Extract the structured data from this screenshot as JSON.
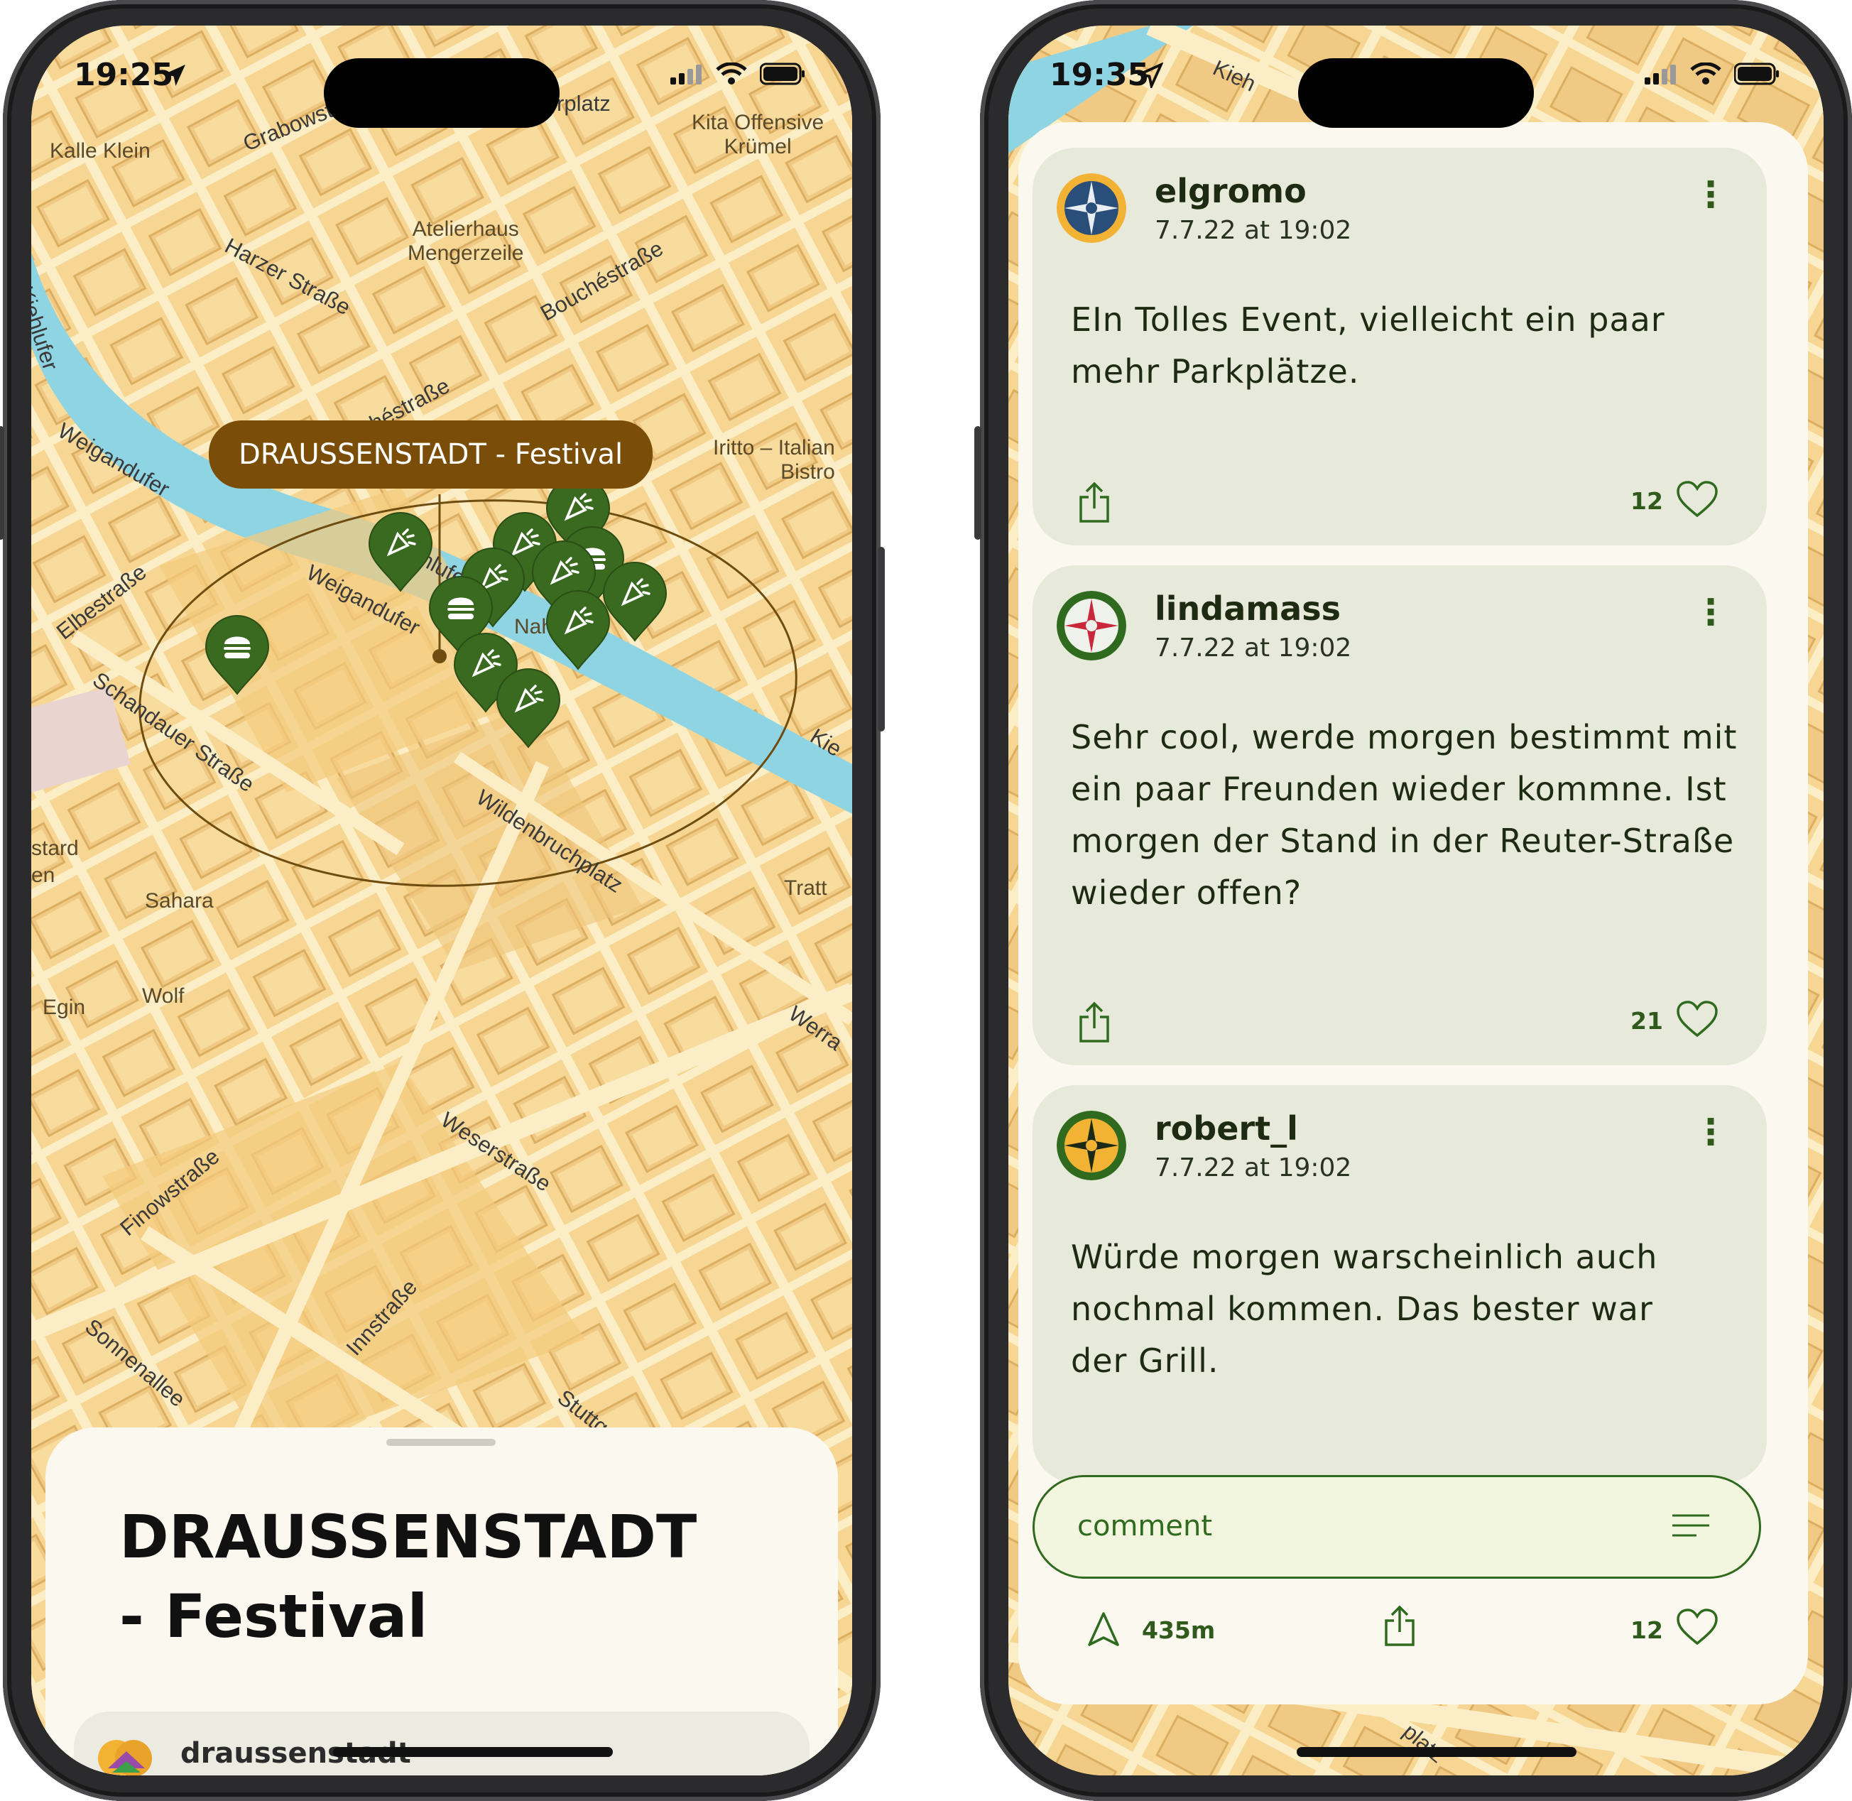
{
  "left_phone": {
    "status_time": "19:25",
    "callout": "DRAUSSENSTADT - Festival",
    "pois": [
      "Kalle Klein",
      "Atelierhaus\nMengerzeile",
      "Kita Offensive\nKrümel",
      "Iritto – Italian\nBistro",
      "Sahara",
      "Wolf",
      "Egin",
      "stard\nen",
      "Tratt",
      "Nah"
    ],
    "streets": [
      "Grabowstr.",
      "Harzer Straße",
      "Bouchéstraße",
      "Kiehlufer",
      "Weigandufer",
      "Elbestraße",
      "Schandauer Straße",
      "Wildenbruchplatz",
      "Weserstraße",
      "Finowstraße",
      "Innstraße",
      "Sonnenallee",
      "Stuttga",
      "Werra",
      "Kie",
      "rplatz",
      "uchéstraße",
      "Kiehlufer"
    ],
    "sheet_title": "DRAUSSENSTADT - Festival",
    "organizer": "draussenstadt"
  },
  "right_phone": {
    "status_time": "19:35",
    "comments": [
      {
        "user": "elgromo",
        "date": "7.7.22 at 19:02",
        "text": "EIn Tolles Event, vielleicht ein paar mehr Parkplätze.",
        "likes": "12"
      },
      {
        "user": "lindamass",
        "date": "7.7.22 at 19:02",
        "text": "Sehr cool, werde morgen bestimmt mit ein paar Freunden wieder kommne. Ist morgen der Stand in der Reuter-Straße wieder offen?",
        "likes": "21"
      },
      {
        "user": "robert_l",
        "date": "7.7.22 at 19:02",
        "text": "Würde morgen warscheinlich auch nochmal kommen.  Das bester war der Grill.",
        "likes": ""
      }
    ],
    "comment_placeholder": "comment",
    "distance": "435m",
    "total_likes": "12",
    "map_fragments": [
      "Kieh",
      "platz"
    ]
  },
  "colors": {
    "accent_green": "#2f6a1e",
    "callout_brown": "#7a4e08",
    "card_bg": "#e7eadb",
    "map_base": "#f6d692",
    "water": "#8fd4e3"
  },
  "icons": [
    "location-arrow-icon",
    "signal-icon",
    "wifi-icon",
    "battery-icon",
    "share-icon",
    "heart-icon",
    "more-icon",
    "menu-lines-icon",
    "navigation-icon",
    "festival-pin-icon",
    "burger-pin-icon"
  ]
}
